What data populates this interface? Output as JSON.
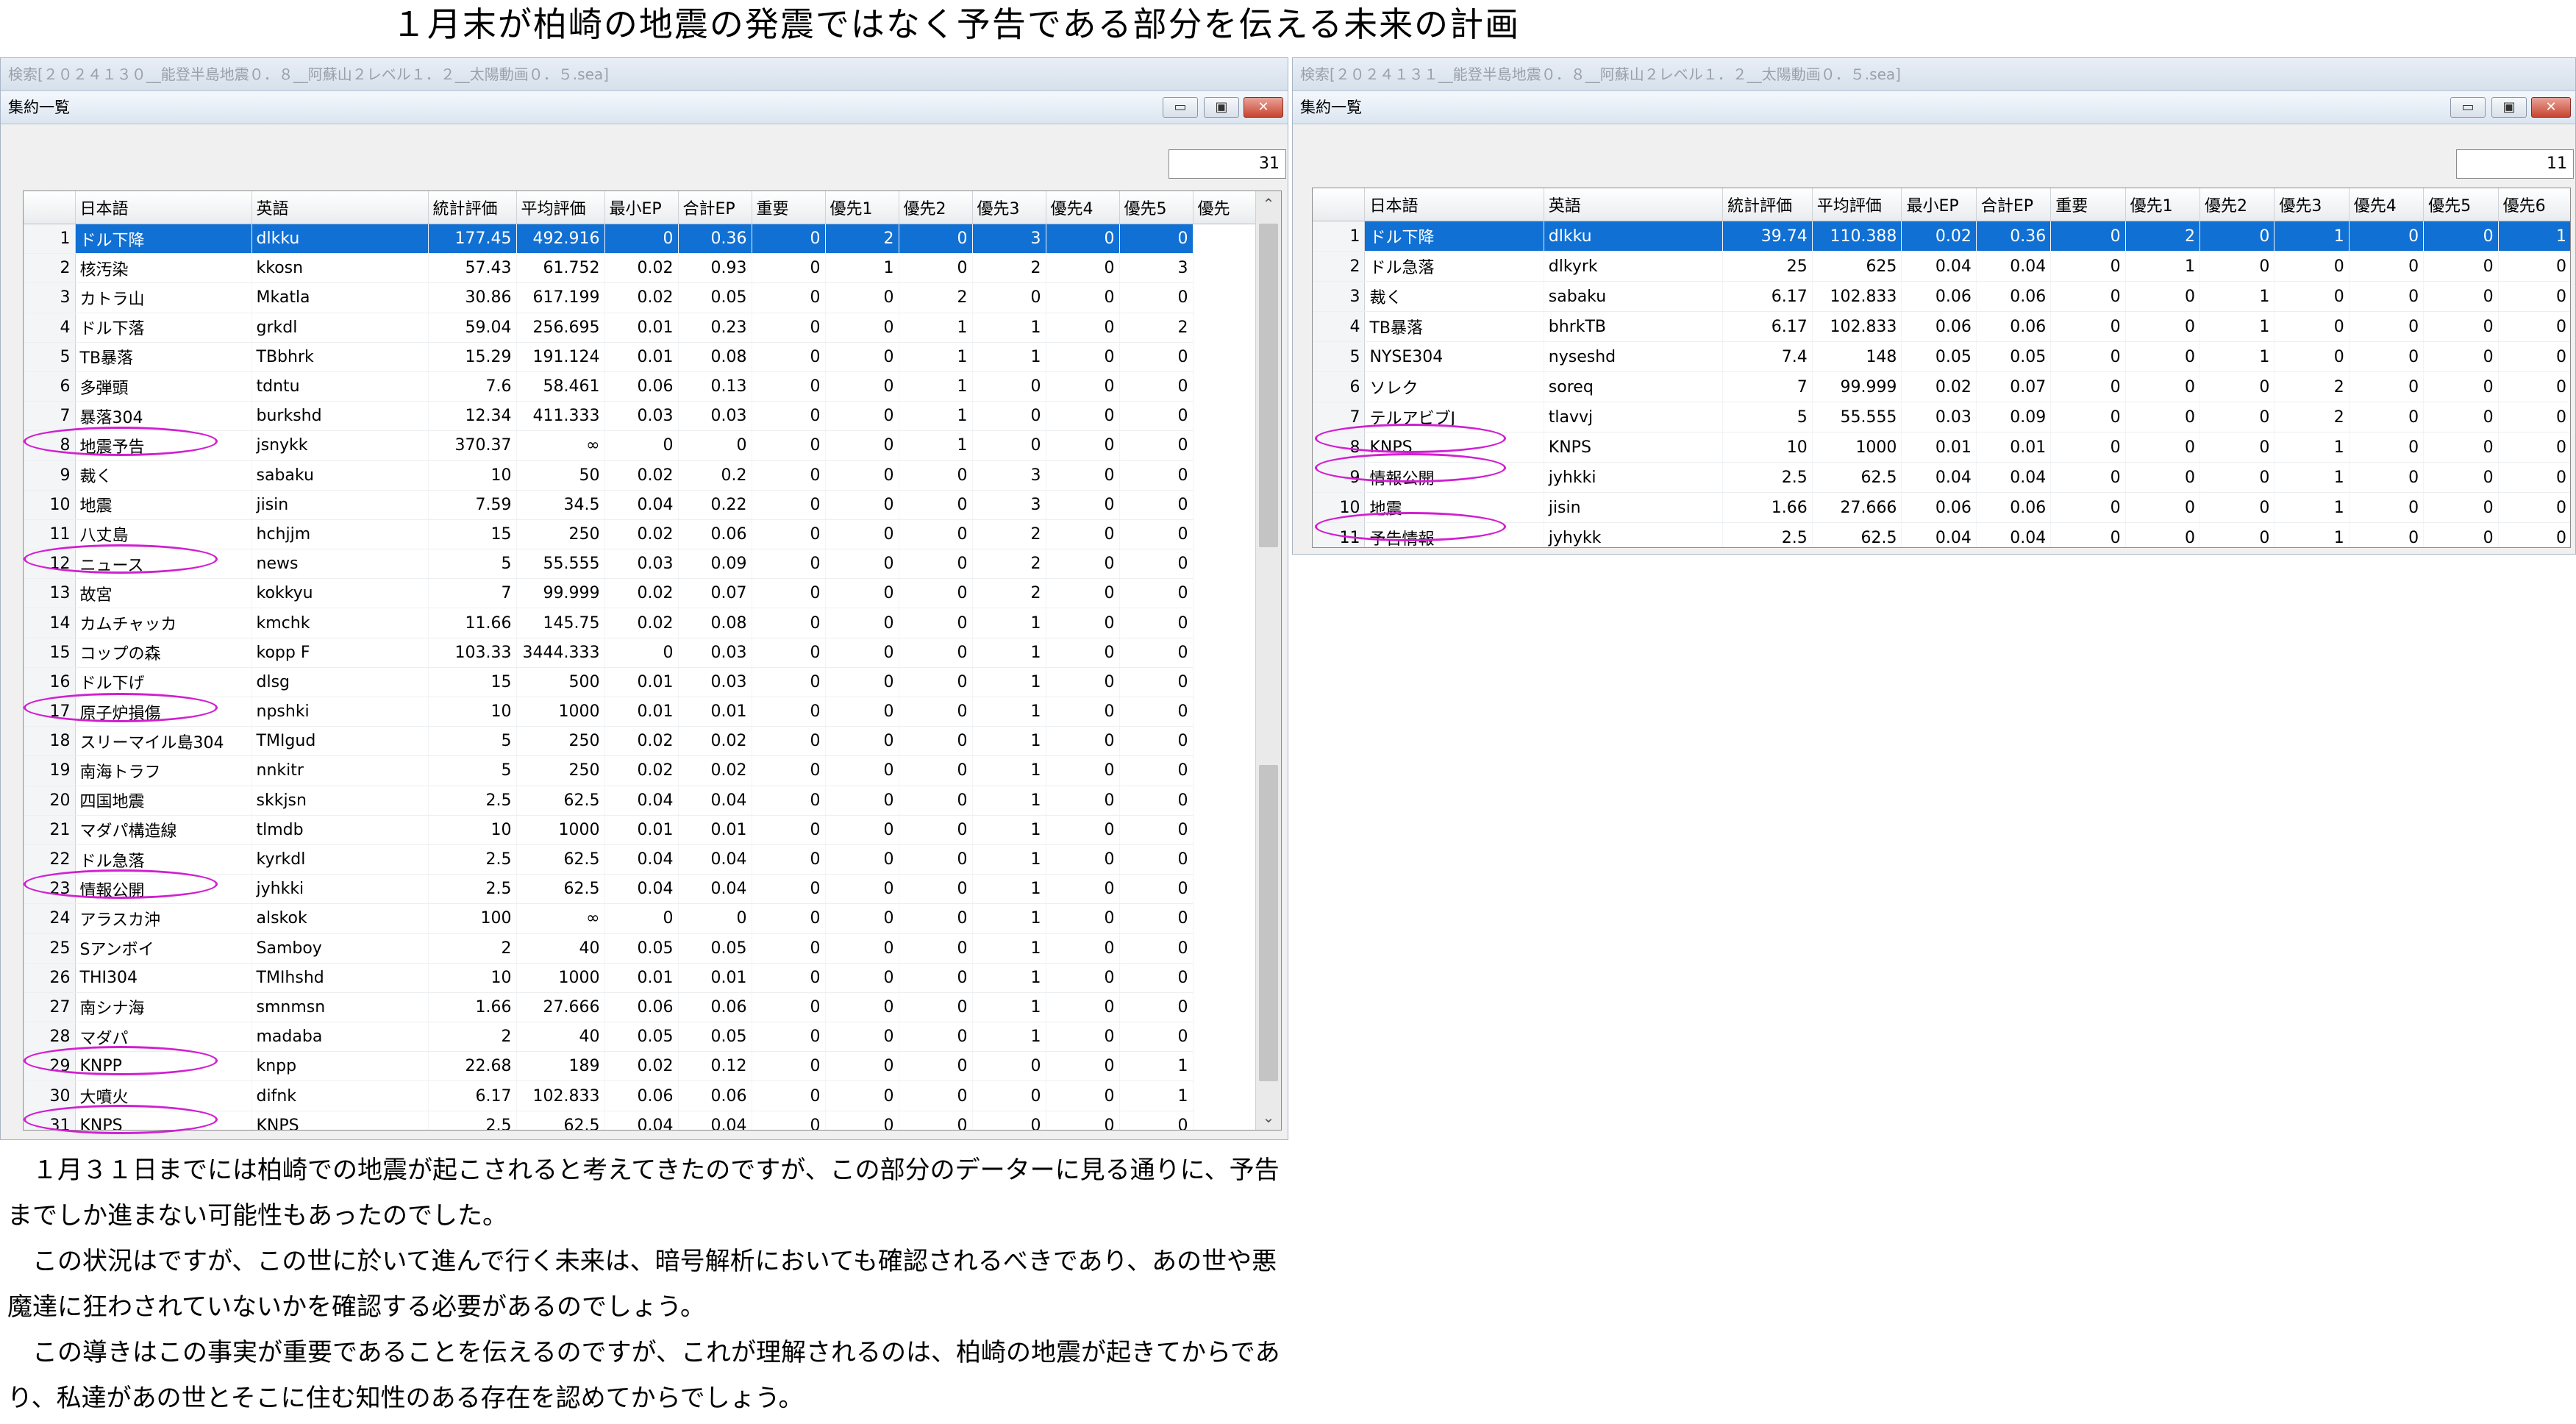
{
  "page_title": "１月末が柏崎の地震の発震ではなく予告である部分を伝える未来の計画",
  "left_window": {
    "outer_title": "検索[２０２４１３０__能登半島地震０．８__阿蘇山２レベル１．２__太陽動画０．５.sea]",
    "inner_title": "集約一覧",
    "count": "31",
    "controls": {
      "min": "▭",
      "max": "▣",
      "close": "✕"
    },
    "columns": [
      "日本語",
      "英語",
      "統計評価",
      "平均評価",
      "最小EP",
      "合計EP",
      "重要",
      "優先1",
      "優先2",
      "優先3",
      "優先4",
      "優先5",
      "優先"
    ],
    "rows": [
      [
        "1",
        "ドル下降",
        "dlkku",
        "177.45",
        "492.916",
        "0",
        "0.36",
        "0",
        "2",
        "0",
        "3",
        "0",
        "0"
      ],
      [
        "2",
        "核汚染",
        "kkosn",
        "57.43",
        "61.752",
        "0.02",
        "0.93",
        "0",
        "1",
        "0",
        "2",
        "0",
        "3"
      ],
      [
        "3",
        "カトラ山",
        "Mkatla",
        "30.86",
        "617.199",
        "0.02",
        "0.05",
        "0",
        "0",
        "2",
        "0",
        "0",
        "0"
      ],
      [
        "4",
        "ドル下落",
        "grkdl",
        "59.04",
        "256.695",
        "0.01",
        "0.23",
        "0",
        "0",
        "1",
        "1",
        "0",
        "2"
      ],
      [
        "5",
        "TB暴落",
        "TBbhrk",
        "15.29",
        "191.124",
        "0.01",
        "0.08",
        "0",
        "0",
        "1",
        "1",
        "0",
        "0"
      ],
      [
        "6",
        "多弾頭",
        "tdntu",
        "7.6",
        "58.461",
        "0.06",
        "0.13",
        "0",
        "0",
        "1",
        "0",
        "0",
        "0"
      ],
      [
        "7",
        "暴落304",
        "burkshd",
        "12.34",
        "411.333",
        "0.03",
        "0.03",
        "0",
        "0",
        "1",
        "0",
        "0",
        "0"
      ],
      [
        "8",
        "地震予告",
        "jsnykk",
        "370.37",
        "∞",
        "0",
        "0",
        "0",
        "0",
        "1",
        "0",
        "0",
        "0"
      ],
      [
        "9",
        "裁く",
        "sabaku",
        "10",
        "50",
        "0.02",
        "0.2",
        "0",
        "0",
        "0",
        "3",
        "0",
        "0"
      ],
      [
        "10",
        "地震",
        "jisin",
        "7.59",
        "34.5",
        "0.04",
        "0.22",
        "0",
        "0",
        "0",
        "3",
        "0",
        "0"
      ],
      [
        "11",
        "八丈島",
        "hchjjm",
        "15",
        "250",
        "0.02",
        "0.06",
        "0",
        "0",
        "0",
        "2",
        "0",
        "0"
      ],
      [
        "12",
        "ニュース",
        "news",
        "5",
        "55.555",
        "0.03",
        "0.09",
        "0",
        "0",
        "0",
        "2",
        "0",
        "0"
      ],
      [
        "13",
        "故宮",
        "kokkyu",
        "7",
        "99.999",
        "0.02",
        "0.07",
        "0",
        "0",
        "0",
        "2",
        "0",
        "0"
      ],
      [
        "14",
        "カムチャッカ",
        "kmchk",
        "11.66",
        "145.75",
        "0.02",
        "0.08",
        "0",
        "0",
        "0",
        "1",
        "0",
        "0"
      ],
      [
        "15",
        "コップの森",
        "kopp F",
        "103.33",
        "3444.333",
        "0",
        "0.03",
        "0",
        "0",
        "0",
        "1",
        "0",
        "0"
      ],
      [
        "16",
        "ドル下げ",
        "dlsg",
        "15",
        "500",
        "0.01",
        "0.03",
        "0",
        "0",
        "0",
        "1",
        "0",
        "0"
      ],
      [
        "17",
        "原子炉損傷",
        "npshki",
        "10",
        "1000",
        "0.01",
        "0.01",
        "0",
        "0",
        "0",
        "1",
        "0",
        "0"
      ],
      [
        "18",
        "スリーマイル島304",
        "TMIgud",
        "5",
        "250",
        "0.02",
        "0.02",
        "0",
        "0",
        "0",
        "1",
        "0",
        "0"
      ],
      [
        "19",
        "南海トラフ",
        "nnkitr",
        "5",
        "250",
        "0.02",
        "0.02",
        "0",
        "0",
        "0",
        "1",
        "0",
        "0"
      ],
      [
        "20",
        "四国地震",
        "skkjsn",
        "2.5",
        "62.5",
        "0.04",
        "0.04",
        "0",
        "0",
        "0",
        "1",
        "0",
        "0"
      ],
      [
        "21",
        "マダパ構造線",
        "tlmdb",
        "10",
        "1000",
        "0.01",
        "0.01",
        "0",
        "0",
        "0",
        "1",
        "0",
        "0"
      ],
      [
        "22",
        "ドル急落",
        "kyrkdl",
        "2.5",
        "62.5",
        "0.04",
        "0.04",
        "0",
        "0",
        "0",
        "1",
        "0",
        "0"
      ],
      [
        "23",
        "情報公開",
        "jyhkki",
        "2.5",
        "62.5",
        "0.04",
        "0.04",
        "0",
        "0",
        "0",
        "1",
        "0",
        "0"
      ],
      [
        "24",
        "アラスカ沖",
        "alskok",
        "100",
        "∞",
        "0",
        "0",
        "0",
        "0",
        "0",
        "1",
        "0",
        "0"
      ],
      [
        "25",
        "Sアンボイ",
        "Samboy",
        "2",
        "40",
        "0.05",
        "0.05",
        "0",
        "0",
        "0",
        "1",
        "0",
        "0"
      ],
      [
        "26",
        "THI304",
        "TMIhshd",
        "10",
        "1000",
        "0.01",
        "0.01",
        "0",
        "0",
        "0",
        "1",
        "0",
        "0"
      ],
      [
        "27",
        "南シナ海",
        "smnmsn",
        "1.66",
        "27.666",
        "0.06",
        "0.06",
        "0",
        "0",
        "0",
        "1",
        "0",
        "0"
      ],
      [
        "28",
        "マダパ",
        "madaba",
        "2",
        "40",
        "0.05",
        "0.05",
        "0",
        "0",
        "0",
        "1",
        "0",
        "0"
      ],
      [
        "29",
        "KNPP",
        "knpp",
        "22.68",
        "189",
        "0.02",
        "0.12",
        "0",
        "0",
        "0",
        "0",
        "0",
        "1"
      ],
      [
        "30",
        "大噴火",
        "difnk",
        "6.17",
        "102.833",
        "0.06",
        "0.06",
        "0",
        "0",
        "0",
        "0",
        "0",
        "1"
      ],
      [
        "31",
        "KNPS",
        "KNPS",
        "2.5",
        "62.5",
        "0.04",
        "0.04",
        "0",
        "0",
        "0",
        "0",
        "0",
        "0"
      ]
    ]
  },
  "right_window": {
    "outer_title": "検索[２０２４１３１__能登半島地震０．８__阿蘇山２レベル１．２__太陽動画０．５.sea]",
    "inner_title": "集約一覧",
    "count": "11",
    "controls": {
      "min": "▭",
      "max": "▣",
      "close": "✕"
    },
    "columns": [
      "日本語",
      "英語",
      "統計評価",
      "平均評価",
      "最小EP",
      "合計EP",
      "重要",
      "優先1",
      "優先2",
      "優先3",
      "優先4",
      "優先5",
      "優先6"
    ],
    "rows": [
      [
        "1",
        "ドル下降",
        "dlkku",
        "39.74",
        "110.388",
        "0.02",
        "0.36",
        "0",
        "2",
        "0",
        "1",
        "0",
        "0",
        "1"
      ],
      [
        "2",
        "ドル急落",
        "dlkyrk",
        "25",
        "625",
        "0.04",
        "0.04",
        "0",
        "1",
        "0",
        "0",
        "0",
        "0",
        "0"
      ],
      [
        "3",
        "裁く",
        "sabaku",
        "6.17",
        "102.833",
        "0.06",
        "0.06",
        "0",
        "0",
        "1",
        "0",
        "0",
        "0",
        "0"
      ],
      [
        "4",
        "TB暴落",
        "bhrkTB",
        "6.17",
        "102.833",
        "0.06",
        "0.06",
        "0",
        "0",
        "1",
        "0",
        "0",
        "0",
        "0"
      ],
      [
        "5",
        "NYSE304",
        "nyseshd",
        "7.4",
        "148",
        "0.05",
        "0.05",
        "0",
        "0",
        "1",
        "0",
        "0",
        "0",
        "0"
      ],
      [
        "6",
        "ソレク",
        "soreq",
        "7",
        "99.999",
        "0.02",
        "0.07",
        "0",
        "0",
        "0",
        "2",
        "0",
        "0",
        "0"
      ],
      [
        "7",
        "テルアビブJ",
        "tlavvj",
        "5",
        "55.555",
        "0.03",
        "0.09",
        "0",
        "0",
        "0",
        "2",
        "0",
        "0",
        "0"
      ],
      [
        "8",
        "KNPS",
        "KNPS",
        "10",
        "1000",
        "0.01",
        "0.01",
        "0",
        "0",
        "0",
        "1",
        "0",
        "0",
        "0"
      ],
      [
        "9",
        "情報公開",
        "jyhkki",
        "2.5",
        "62.5",
        "0.04",
        "0.04",
        "0",
        "0",
        "0",
        "1",
        "0",
        "0",
        "0"
      ],
      [
        "10",
        "地震",
        "jisin",
        "1.66",
        "27.666",
        "0.06",
        "0.06",
        "0",
        "0",
        "0",
        "1",
        "0",
        "0",
        "0"
      ],
      [
        "11",
        "予告情報",
        "jyhykk",
        "2.5",
        "62.5",
        "0.04",
        "0.04",
        "0",
        "0",
        "0",
        "1",
        "0",
        "0",
        "0"
      ]
    ]
  },
  "paragraphs": [
    "　１月３１日までには柏崎での地震が起こされると考えてきたのですが、この部分のデーターに見る通りに、予告までしか進まない可能性もあったのでした。",
    "　この状況はですが、この世に於いて進んで行く未来は、暗号解析においても確認されるべきであり、あの世や悪魔達に狂わされていないかを確認する必要があるのでしょう。",
    "　この導きはこの事実が重要であることを伝えるのですが、これが理解されるのは、柏崎の地震が起きてからであり、私達があの世とそこに住む知性のある存在を認めてからでしょう。"
  ],
  "colors": {
    "selection": "#1070d4",
    "highlight_ring": "#d11fd1"
  }
}
